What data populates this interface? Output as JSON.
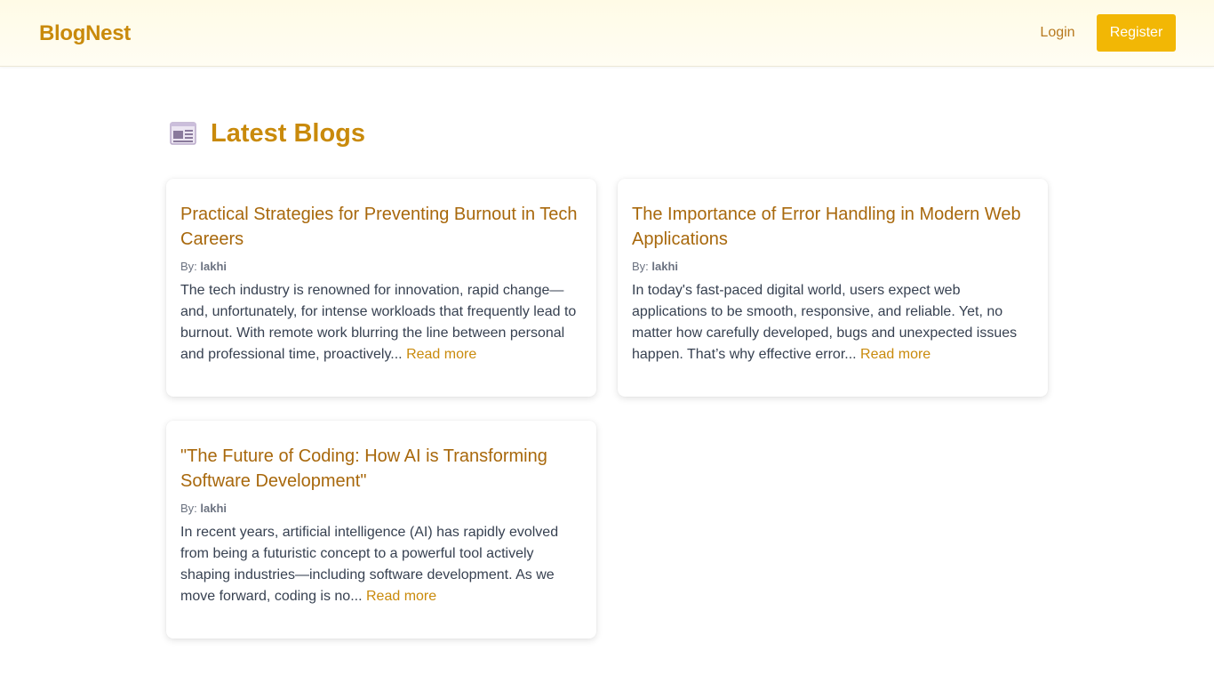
{
  "nav": {
    "brand": "BlogNest",
    "login": "Login",
    "register": "Register"
  },
  "page": {
    "heading": "Latest Blogs",
    "heading_icon": "newspaper-icon"
  },
  "posts": [
    {
      "title": "Practical Strategies for Preventing Burnout in Tech Careers",
      "by_label": "By:",
      "author": "lakhi",
      "excerpt": "The tech industry is renowned for innovation, rapid change—and, unfortunately, for intense workloads that frequently lead to burnout. With remote work blurring the line between personal and professional time, proactively...",
      "read_more": "Read more"
    },
    {
      "title": "The Importance of Error Handling in Modern Web Applications",
      "by_label": "By:",
      "author": "lakhi",
      "excerpt": "In today's fast-paced digital world, users expect web applications to be smooth, responsive, and reliable. Yet, no matter how carefully developed, bugs and unexpected issues happen. That’s why effective error...",
      "read_more": "Read more"
    },
    {
      "title": "\"The Future of Coding: How AI is Transforming Software Development\"",
      "by_label": "By:",
      "author": "lakhi",
      "excerpt": "In recent years, artificial intelligence (AI) has rapidly evolved from being a futuristic concept to a powerful tool actively shaping industries—including software development. As we move forward, coding is no...",
      "read_more": "Read more"
    }
  ],
  "colors": {
    "brand": "#c98a0b",
    "accent_button": "#f2b705",
    "title": "#a8680c"
  }
}
